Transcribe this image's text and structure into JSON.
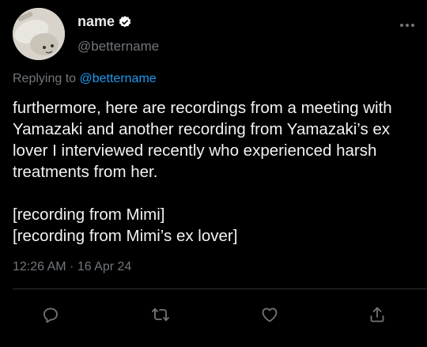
{
  "author": {
    "display_name": "name",
    "handle": "@betternamе"
  },
  "reply": {
    "prefix": "Replying to",
    "mention": "@betternamе"
  },
  "tweet": {
    "text": "furthermore, here are recordings from a meeting with Yamazaki and another recording from Yamazaki’s ex lover I interviewed recently who experienced harsh treatments from her.\n\n[recording from Mimi]\n[recording from Mimi’s ex lover]",
    "timestamp": "12:26 AM · 16 Apr 24"
  },
  "icons": {
    "verified": "verified-badge-icon",
    "more": "more-options-icon",
    "reply": "reply-icon",
    "retweet": "retweet-icon",
    "like": "heart-icon",
    "share": "share-icon"
  },
  "colors": {
    "background": "#000000",
    "text": "#e7e9ea",
    "secondary": "#71767b",
    "accent": "#1d9bf0",
    "divider": "#2f3336"
  }
}
